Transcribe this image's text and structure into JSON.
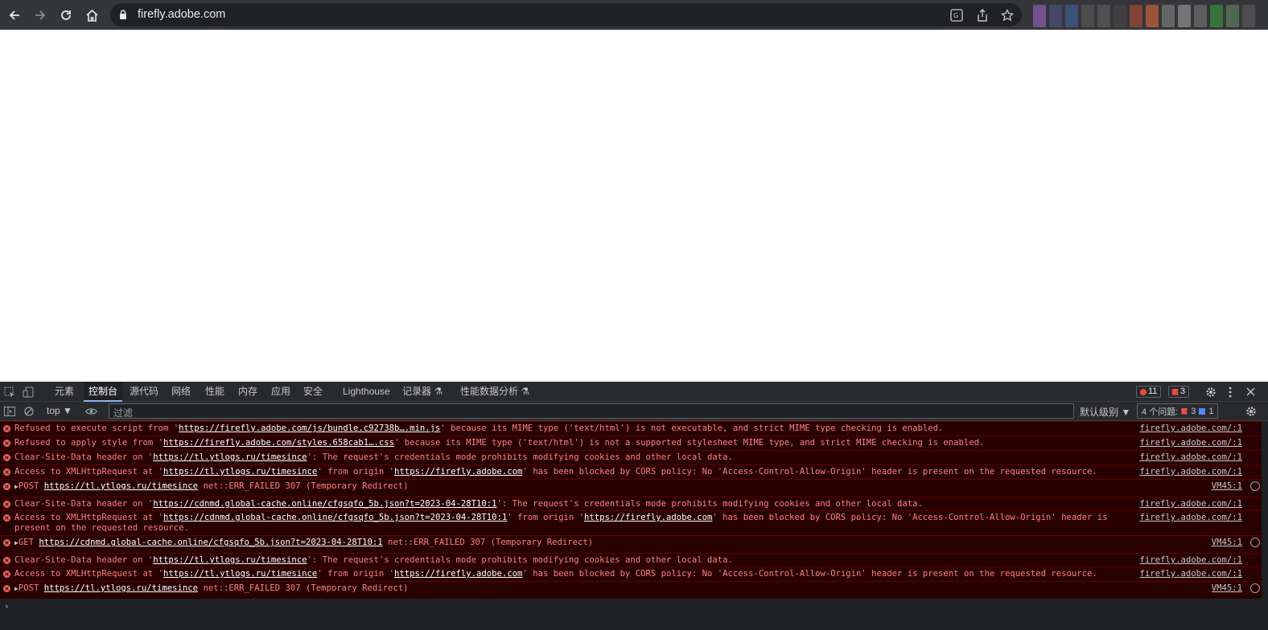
{
  "browser": {
    "url": "firefly.adobe.com",
    "extension_colors": [
      "#8a5ca8",
      "#4a4f7a",
      "#3d5c8a",
      "#555555",
      "#5a5a5a",
      "#444444",
      "#9a4a3a",
      "#c0603a",
      "#777777",
      "#8a8a8a",
      "#6a6a6a",
      "#3a8a3a",
      "#5a7a5a",
      "#555555"
    ]
  },
  "devtools": {
    "tabs": [
      {
        "label": "元素"
      },
      {
        "label": "控制台"
      },
      {
        "label": "源代码"
      },
      {
        "label": "网络"
      },
      {
        "label": "性能"
      },
      {
        "label": "内存"
      },
      {
        "label": "应用"
      },
      {
        "label": "安全"
      },
      {
        "label": "Lighthouse"
      },
      {
        "label": "记录器 ⚗"
      },
      {
        "label": "性能数据分析 ⚗"
      }
    ],
    "active_tab": "控制台",
    "error_count": "11",
    "issue_flag_count": "3",
    "toolbar": {
      "context": "top ▼",
      "filter_placeholder": "过滤",
      "level": "默认级别 ▼",
      "issues_label": "4 个问题:",
      "issues_red": "3",
      "issues_blue": "1"
    },
    "messages": [
      {
        "parts": [
          "Refused to execute script from '",
          {
            "link": "https://firefly.adobe.com/js/bundle.c92738b….min.js"
          },
          "' because its MIME type ('text/html') is not executable, and strict MIME type checking is enabled."
        ],
        "source": "firefly.adobe.com/:1"
      },
      {
        "parts": [
          "Refused to apply style from '",
          {
            "link": "https://firefly.adobe.com/styles.658cab1….css"
          },
          "' because its MIME type ('text/html') is not a supported stylesheet MIME type, and strict MIME checking is enabled."
        ],
        "source": "firefly.adobe.com/:1"
      },
      {
        "parts": [
          "Clear-Site-Data header on '",
          {
            "link": "https://tl.ytlogs.ru/timesince"
          },
          "': The request's credentials mode prohibits modifying cookies and other local data."
        ],
        "source": "firefly.adobe.com/:1"
      },
      {
        "parts": [
          "Access to XMLHttpRequest at '",
          {
            "link": "https://tl.ytlogs.ru/timesince"
          },
          "' from origin '",
          {
            "link": "https://firefly.adobe.com"
          },
          "' has been blocked by CORS policy: No 'Access-Control-Allow-Origin' header is present on the requested resource."
        ],
        "source": "firefly.adobe.com/:1"
      },
      {
        "expand": true,
        "parts": [
          "POST ",
          {
            "link": "https://tl.ytlogs.ru/timesince"
          },
          " net::ERR_FAILED 307 (Temporary Redirect)"
        ],
        "source": "VM45:1",
        "redo": true
      },
      {
        "parts": [
          "Clear-Site-Data header on '",
          {
            "link": "https://cdnmd.global-cache.online/cfgsqfo_5b.json?t=2023-04-28T10:1"
          },
          "': The request's credentials mode prohibits modifying cookies and other local data."
        ],
        "source": "firefly.adobe.com/:1"
      },
      {
        "parts": [
          "Access to XMLHttpRequest at '",
          {
            "link": "https://cdnmd.global-cache.online/cfgsqfo_5b.json?t=2023-04-28T10:1"
          },
          "' from origin '",
          {
            "link": "https://firefly.adobe.com"
          },
          "' has been blocked by CORS policy: No 'Access-Control-Allow-Origin' header is present on the requested resource."
        ],
        "source": "firefly.adobe.com/:1"
      },
      {
        "expand": true,
        "parts": [
          "GET ",
          {
            "link": "https://cdnmd.global-cache.online/cfgsqfo_5b.json?t=2023-04-28T10:1"
          },
          " net::ERR_FAILED 307 (Temporary Redirect)"
        ],
        "source": "VM45:1",
        "redo": true
      },
      {
        "parts": [
          "Clear-Site-Data header on '",
          {
            "link": "https://tl.ytlogs.ru/timesince"
          },
          "': The request's credentials mode prohibits modifying cookies and other local data."
        ],
        "source": "firefly.adobe.com/:1"
      },
      {
        "parts": [
          "Access to XMLHttpRequest at '",
          {
            "link": "https://tl.ytlogs.ru/timesince"
          },
          "' from origin '",
          {
            "link": "https://firefly.adobe.com"
          },
          "' has been blocked by CORS policy: No 'Access-Control-Allow-Origin' header is present on the requested resource."
        ],
        "source": "firefly.adobe.com/:1"
      },
      {
        "expand": true,
        "parts": [
          "POST ",
          {
            "link": "https://tl.ytlogs.ru/timesince"
          },
          " net::ERR_FAILED 307 (Temporary Redirect)"
        ],
        "source": "VM45:1",
        "redo": true
      }
    ],
    "prompt": "›"
  }
}
